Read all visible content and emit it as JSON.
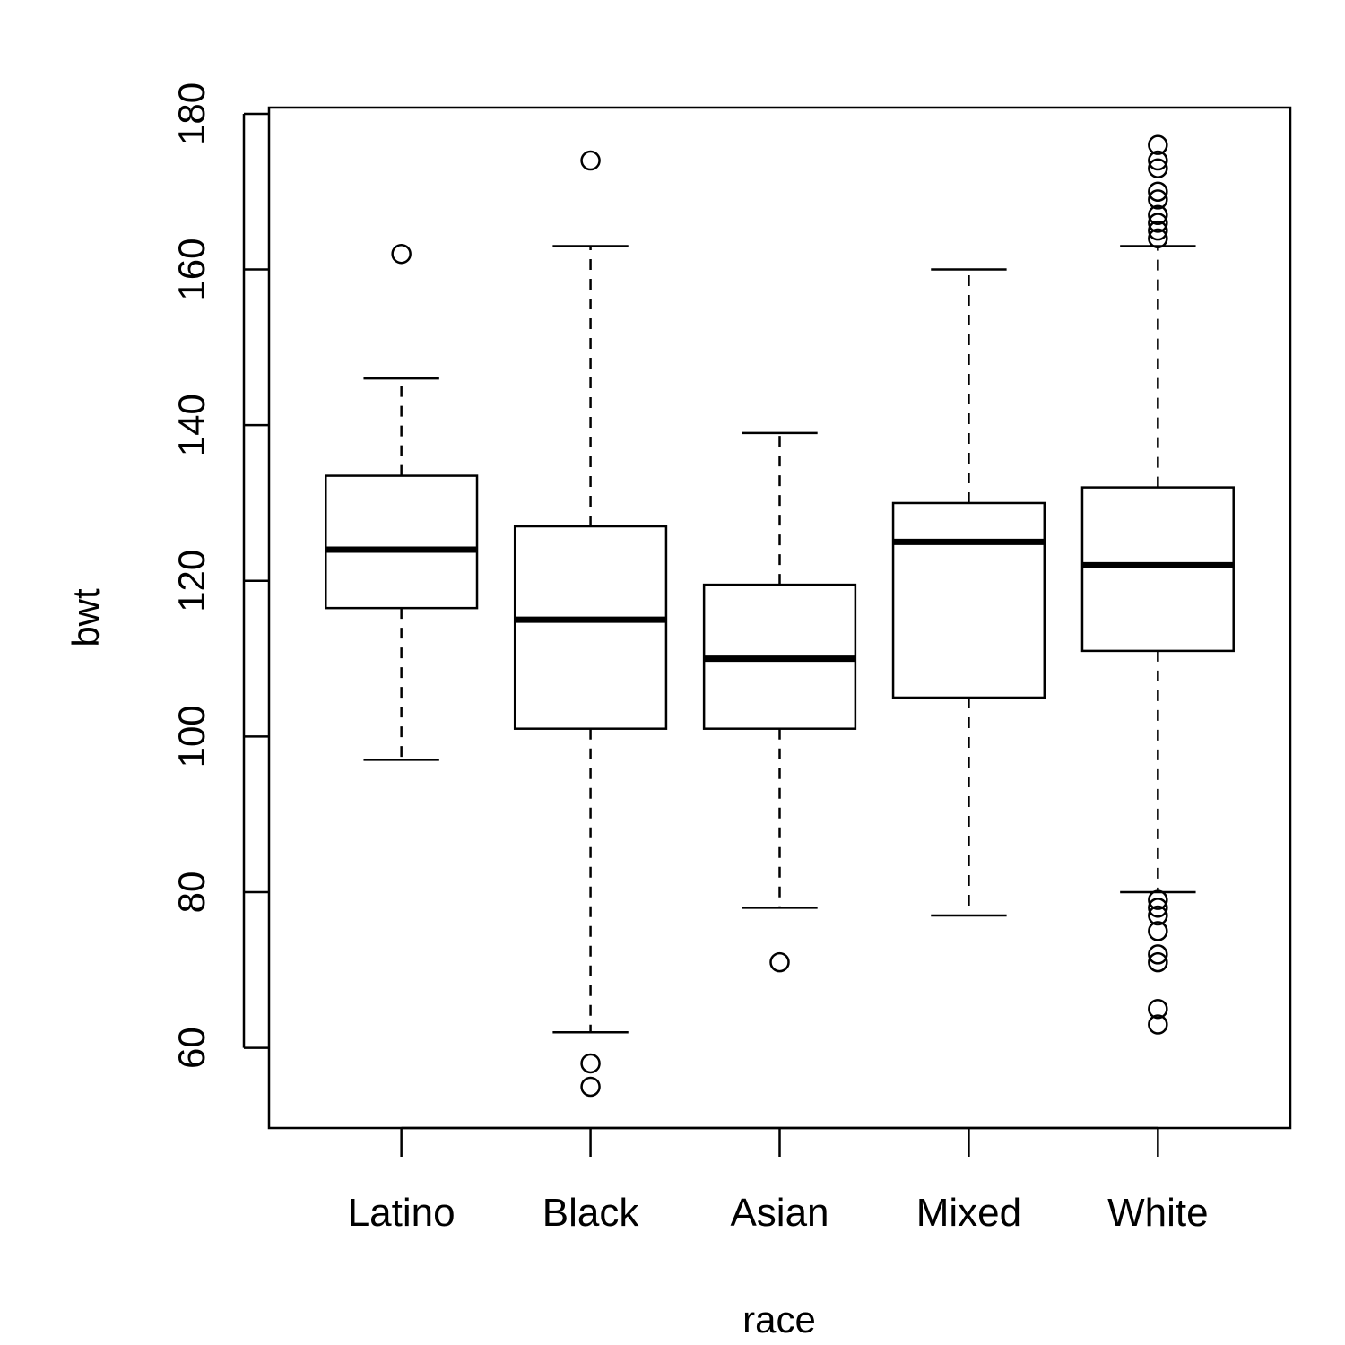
{
  "chart_data": {
    "type": "boxplot",
    "title": "",
    "xlabel": "race",
    "ylabel": "bwt",
    "ylim": [
      49.7,
      180.8
    ],
    "yticks": [
      60,
      80,
      100,
      120,
      140,
      160,
      180
    ],
    "ytick_labels": [
      "60",
      "80",
      "100",
      "120",
      "140",
      "160",
      "180"
    ],
    "grid": false,
    "legend": "none",
    "categories": [
      "Latino",
      "Black",
      "Asian",
      "Mixed",
      "White"
    ],
    "boxes": [
      {
        "name": "Latino",
        "whisker_low": 97,
        "q1": 116.5,
        "median": 124,
        "q3": 133.5,
        "whisker_high": 146,
        "outliers": [
          162
        ]
      },
      {
        "name": "Black",
        "whisker_low": 62,
        "q1": 101,
        "median": 115,
        "q3": 127,
        "whisker_high": 163,
        "outliers": [
          174,
          58,
          55
        ]
      },
      {
        "name": "Asian",
        "whisker_low": 78,
        "q1": 101,
        "median": 110,
        "q3": 119.5,
        "whisker_high": 139,
        "outliers": [
          71
        ]
      },
      {
        "name": "Mixed",
        "whisker_low": 77,
        "q1": 105,
        "median": 125,
        "q3": 130,
        "whisker_high": 160,
        "outliers": []
      },
      {
        "name": "White",
        "whisker_low": 80,
        "q1": 111,
        "median": 122,
        "q3": 132,
        "whisker_high": 163,
        "outliers": [
          176,
          174,
          173,
          170,
          169,
          167,
          166,
          165,
          164,
          79,
          78,
          77,
          75,
          72,
          71,
          65,
          63
        ]
      }
    ]
  }
}
